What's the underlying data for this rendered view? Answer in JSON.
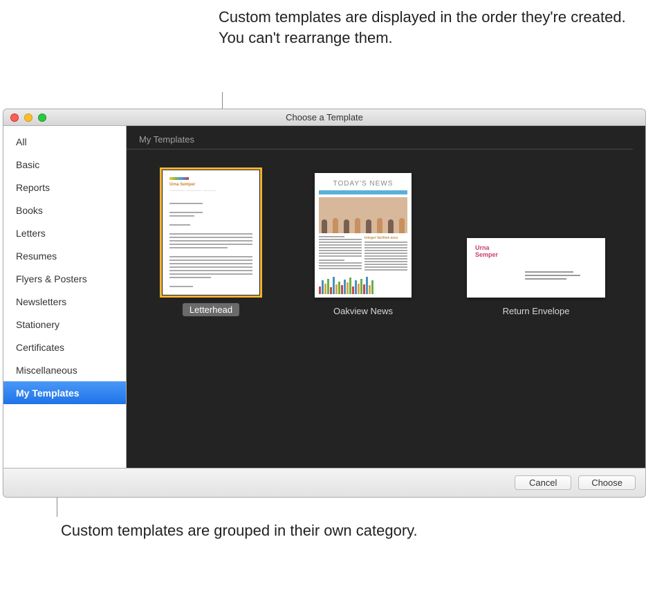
{
  "callouts": {
    "top": "Custom templates are displayed in the order they're created. You can't rearrange them.",
    "bottom": "Custom templates are grouped in their own category."
  },
  "window": {
    "title": "Choose a Template"
  },
  "sidebar": {
    "items": [
      {
        "label": "All",
        "selected": false
      },
      {
        "label": "Basic",
        "selected": false
      },
      {
        "label": "Reports",
        "selected": false
      },
      {
        "label": "Books",
        "selected": false
      },
      {
        "label": "Letters",
        "selected": false
      },
      {
        "label": "Resumes",
        "selected": false
      },
      {
        "label": "Flyers & Posters",
        "selected": false
      },
      {
        "label": "Newsletters",
        "selected": false
      },
      {
        "label": "Stationery",
        "selected": false
      },
      {
        "label": "Certificates",
        "selected": false
      },
      {
        "label": "Miscellaneous",
        "selected": false
      },
      {
        "label": "My Templates",
        "selected": true
      }
    ]
  },
  "content": {
    "section_header": "My Templates",
    "templates": [
      {
        "label": "Letterhead",
        "selected": true,
        "shape": "portrait"
      },
      {
        "label": "Oakview News",
        "selected": false,
        "shape": "portrait"
      },
      {
        "label": "Return Envelope",
        "selected": false,
        "shape": "envelope"
      }
    ],
    "newsletter_thumb": {
      "headline": "TODAY'S NEWS",
      "subhead": "Integer facilisis arcu"
    },
    "envelope_thumb": {
      "name1": "Urna",
      "name2": "Semper"
    },
    "letterhead_thumb": {
      "name": "Urna Semper"
    }
  },
  "footer": {
    "cancel": "Cancel",
    "choose": "Choose"
  }
}
